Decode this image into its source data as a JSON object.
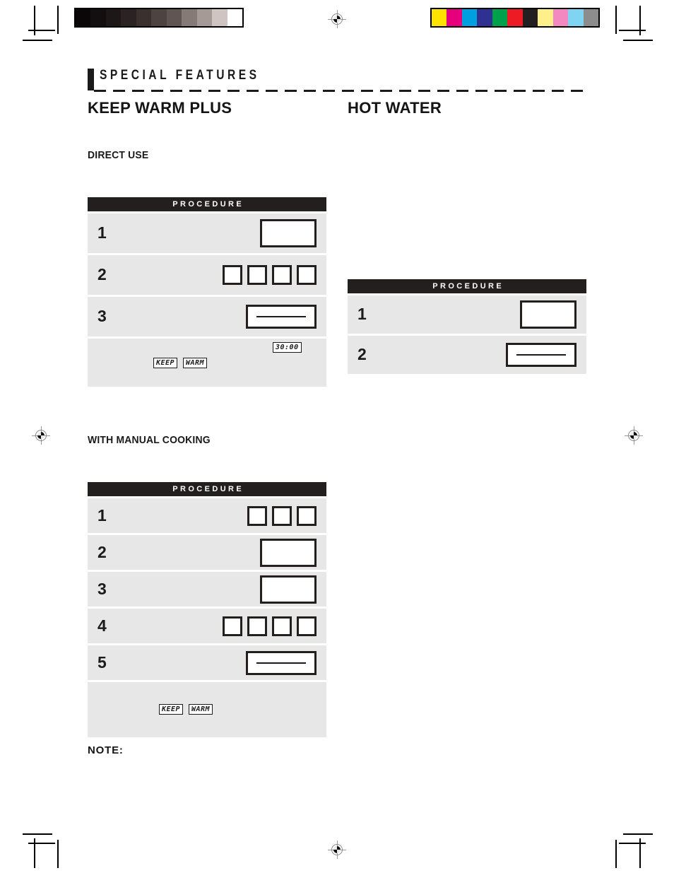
{
  "page": {
    "section_header": "SPECIAL FEATURES",
    "columns": {
      "left_title": "KEEP WARM PLUS",
      "right_title": "HOT WATER"
    },
    "subheads": {
      "direct_use": "DIRECT USE",
      "with_manual_cooking": "WITH MANUAL COOKING"
    },
    "note_label": "NOTE:"
  },
  "tables": {
    "direct_use": {
      "header": "PROCEDURE",
      "rows": [
        {
          "step": "1",
          "keys": [
            {
              "type": "rect"
            }
          ]
        },
        {
          "step": "2",
          "keys": [
            {
              "type": "sq"
            },
            {
              "type": "sq"
            },
            {
              "type": "sq"
            },
            {
              "type": "sq"
            }
          ]
        },
        {
          "step": "3",
          "keys": [
            {
              "type": "wide"
            }
          ]
        }
      ],
      "display_row": {
        "indicators": [
          "KEEP",
          "WARM"
        ],
        "timer": "30:00"
      }
    },
    "with_manual_cooking": {
      "header": "PROCEDURE",
      "rows": [
        {
          "step": "1",
          "keys": [
            {
              "type": "sq"
            },
            {
              "type": "sq"
            },
            {
              "type": "sq"
            }
          ]
        },
        {
          "step": "2",
          "keys": [
            {
              "type": "rect"
            }
          ]
        },
        {
          "step": "3",
          "keys": [
            {
              "type": "rect"
            }
          ]
        },
        {
          "step": "4",
          "keys": [
            {
              "type": "sq"
            },
            {
              "type": "sq"
            },
            {
              "type": "sq"
            },
            {
              "type": "sq"
            }
          ]
        },
        {
          "step": "5",
          "keys": [
            {
              "type": "wide"
            }
          ]
        }
      ],
      "display_row": {
        "indicators": [
          "KEEP",
          "WARM"
        ],
        "timer": ""
      }
    },
    "hot_water": {
      "header": "PROCEDURE",
      "rows": [
        {
          "step": "1",
          "keys": [
            {
              "type": "rect"
            }
          ]
        },
        {
          "step": "2",
          "keys": [
            {
              "type": "wide"
            }
          ]
        }
      ]
    }
  },
  "prepress": {
    "grayscale_wedge": [
      "#0b0708",
      "#130e0f",
      "#1d1717",
      "#2b2323",
      "#3a312f",
      "#4d4341",
      "#605552",
      "#857a76",
      "#a59a96",
      "#cfc4c1",
      "#ffffff"
    ],
    "color_bar": [
      "#ffe400",
      "#e6007e",
      "#00a0e0",
      "#2e3192",
      "#00a14b",
      "#ed1c24",
      "#231f20",
      "#fdf08a",
      "#f387c0",
      "#7fd4f2",
      "#8c8c8c"
    ]
  }
}
